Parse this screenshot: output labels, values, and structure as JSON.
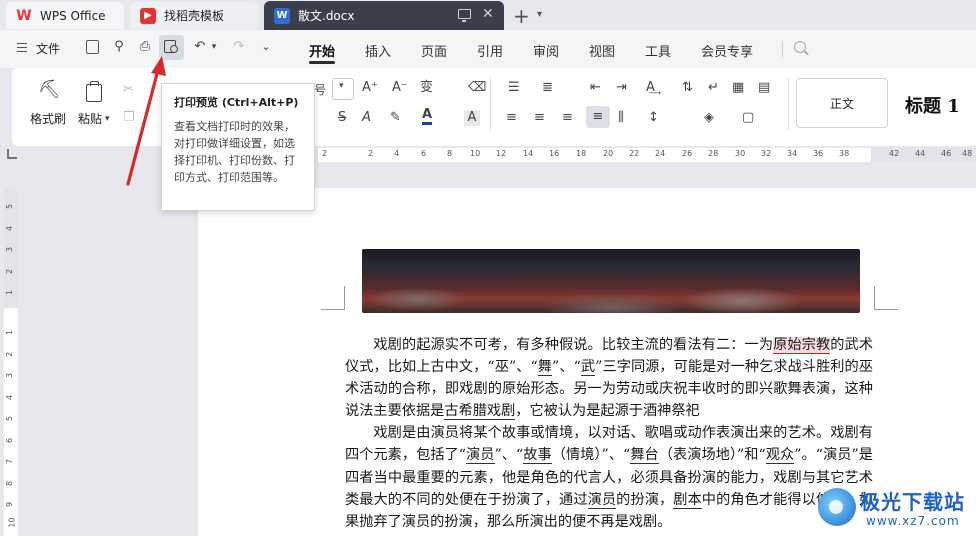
{
  "tabs": {
    "wps_title": "WPS Office",
    "template_title": "找稻壳模板",
    "doc_title": "散文.docx"
  },
  "menu": {
    "file_label": "文件",
    "items": [
      "开始",
      "插入",
      "页面",
      "引用",
      "审阅",
      "视图",
      "工具",
      "会员专享"
    ],
    "active": "开始"
  },
  "ribbon": {
    "format_painter": "格式刷",
    "paste": "粘贴",
    "style_normal": "正文",
    "style_heading1": "标题 1",
    "font_size_partial": "号"
  },
  "tooltip": {
    "title": "打印预览 (Ctrl+Alt+P)",
    "body": "查看文档打印时的效果，对打印做详细设置，如选择打印机、打印份数、打印方式、打印范围等。"
  },
  "ruler": {
    "h_numbers": [
      "2",
      "2",
      "4",
      "6",
      "8",
      "10",
      "12",
      "14",
      "16",
      "18",
      "20",
      "22",
      "24",
      "26",
      "28",
      "30",
      "32",
      "34",
      "36",
      "38",
      "42",
      "44",
      "46",
      "48"
    ],
    "v_numbers": [
      "5",
      "4",
      "3",
      "2",
      "1",
      "1",
      "2",
      "3",
      "4",
      "5",
      "6",
      "7",
      "8",
      "9",
      "10"
    ]
  },
  "document": {
    "p1_a": "戏剧的起源实不可考，有多种假说。比较主流的看法有二：一为",
    "p1_hl": "原始宗教",
    "p1_b": "的武术仪式，比如上古中文，“巫”、“",
    "p1_wu": "舞",
    "p1_c": "”、“",
    "p1_wu2": "武",
    "p1_d": "”三字同源，可能是对一种乞求战斗胜利的巫术活动的合称，即戏剧的原始形态。另一为劳动或庆祝丰收时的即兴歌舞表演，这种说法主要依据是",
    "p1_greek": "古希腊戏剧",
    "p1_e": "，它被认为是起源于酒神祭祀",
    "p2_a": "戏剧是由演员将某个故事或情境，以对话、歌唱或动作表演出来的艺术。戏剧有四个元素，包括了“",
    "p2_actor": "演员",
    "p2_b": "”、“",
    "p2_story": "故事",
    "p2_c": "（情境）”、“",
    "p2_stage": "舞台",
    "p2_d": "（表演场地）”和“",
    "p2_aud": "观众",
    "p2_e": "”。“演员”是四者当中最重要的元素，他是角色的代言人，必须具备扮演的能力，戏剧与其它艺术类最大的不同的处便在于扮演了，通过",
    "p2_actor2": "演员",
    "p2_f": "的扮演，",
    "p2_script": "剧本",
    "p2_g": "中的角色才能得以伸张，如果抛弃了演员的扮演，那么所演出的便不再是戏剧。",
    "p3": "戏剧"
  },
  "watermark": {
    "name": "极光下载站",
    "url": "www.xz7.com"
  },
  "colors": {
    "accent_red": "#e63434",
    "doc_tab_bg": "#3a3f4b",
    "word_blue": "#2f6ddb",
    "arrow_red": "#d42a2a"
  }
}
